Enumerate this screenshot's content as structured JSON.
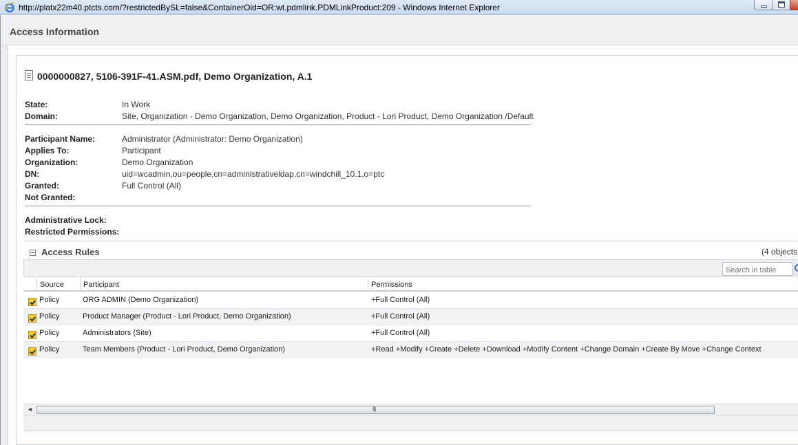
{
  "window": {
    "title": "http://platx22m40.ptcts.com/?restrictedBySL=false&ContainerOid=OR:wt.pdmlink.PDMLinkProduct:209 - Windows Internet Explorer"
  },
  "page": {
    "title": "Access Information"
  },
  "object": {
    "title": "0000000827, 5106-391F-41.ASM.pdf, Demo Organization, A.1"
  },
  "properties": {
    "state_label": "State:",
    "state_value": "In Work",
    "domain_label": "Domain:",
    "domain_value": "Site, Organization - Demo Organization, Demo Organization, Product - Lori Product, Demo Organization /Default",
    "participant_name_label": "Participant Name:",
    "participant_name_value": "Administrator (Administrator: Demo Organization)",
    "applies_to_label": "Applies To:",
    "applies_to_value": "Participant",
    "organization_label": "Organization:",
    "organization_value": "Demo Organization",
    "dn_label": "DN:",
    "dn_value": "uid=wcadmin,ou=people,cn=administrativeldap,cn=windchill_10.1,o=ptc",
    "granted_label": "Granted:",
    "granted_value": "Full Control (All)",
    "not_granted_label": "Not Granted:",
    "admin_lock_label": "Administrative Lock:",
    "restricted_label": "Restricted Permissions:"
  },
  "access_rules": {
    "title": "Access Rules",
    "count": "(4 objects",
    "search_placeholder": "Search in table",
    "columns": [
      "Source",
      "Participant",
      "Permissions"
    ],
    "rows": [
      {
        "source": "Policy",
        "participant": "ORG ADMIN (Demo Organization)",
        "permissions": "+Full Control (All)"
      },
      {
        "source": "Policy",
        "participant": "Product Manager (Product - Lori Product, Demo Organization)",
        "permissions": "+Full Control (All)"
      },
      {
        "source": "Policy",
        "participant": "Administrators (Site)",
        "permissions": "+Full Control (All)"
      },
      {
        "source": "Policy",
        "participant": "Team Members (Product - Lori Product, Demo Organization)",
        "permissions": "+Read +Modify +Create +Delete +Download +Modify Content +Change Domain +Create By Move +Change Context"
      }
    ],
    "scroll_left_arrow": "◄",
    "scroll_grip": "III"
  }
}
